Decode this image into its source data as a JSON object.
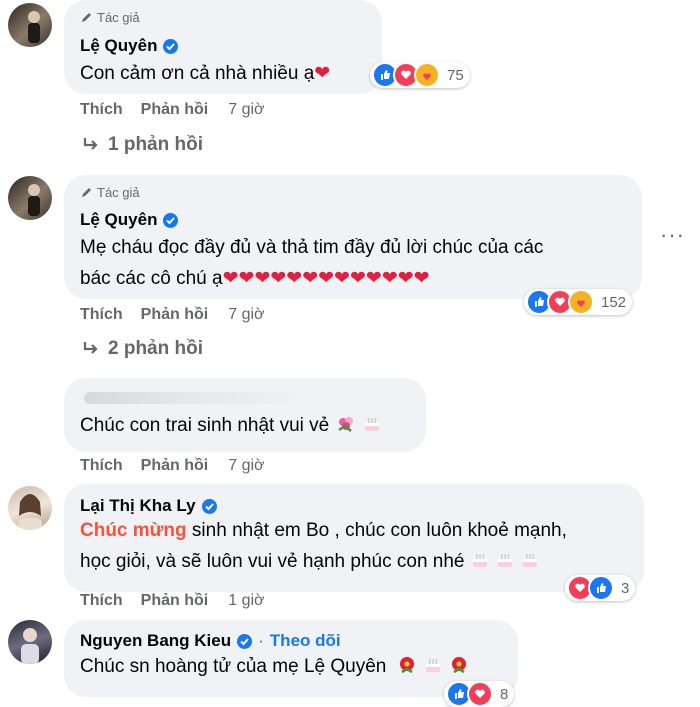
{
  "comments": [
    {
      "author_badge": "Tác giả",
      "author": "Lệ Quyên",
      "text": "Con cảm ơn cả nhà nhiều ạ❤",
      "reaction_count": "75",
      "like": "Thích",
      "reply": "Phản hồi",
      "time": "7 giờ",
      "replies_label": "1 phản hồi"
    },
    {
      "author_badge": "Tác giả",
      "author": "Lệ Quyên",
      "text_line1": "Mẹ cháu đọc đầy đủ và thả tim đầy đủ lời chúc của các",
      "text_line2": "bác các cô chú ạ❤❤❤❤❤❤❤❤❤❤❤❤❤",
      "reaction_count": "152",
      "like": "Thích",
      "reply": "Phản hồi",
      "time": "7 giờ",
      "replies_label": "2 phản hồi",
      "more": "···"
    },
    {
      "text": "Chúc con trai sinh nhật vui vẻ",
      "like": "Thích",
      "reply": "Phản hồi",
      "time": "7 giờ"
    },
    {
      "author": "Lại Thị Kha Ly",
      "highlight": "Chúc mừng",
      "text_line1_rest": " sinh nhật em Bo , chúc con luôn khoẻ mạnh,",
      "text_line2": "học giỏi, và sẽ luôn vui vẻ hạnh phúc con nhé",
      "reaction_count": "3",
      "like": "Thích",
      "reply": "Phản hồi",
      "time": "1 giờ"
    },
    {
      "author": "Nguyen Bang Kieu",
      "follow": "Theo dõi",
      "text": "Chúc sn hoàng tử của mẹ ",
      "mention": "Lệ Quyên",
      "reaction_count": "8"
    }
  ],
  "colors": {
    "bubble": "#f0f2f5",
    "secondary_text": "#65676b",
    "link_blue": "#1877f2",
    "highlight_orange": "#f5533d",
    "like_blue": "#1877f2",
    "love_red": "#f33e58",
    "care_yellow": "#f7b125"
  },
  "icons": [
    "pencil-icon",
    "verified-icon",
    "like-icon",
    "love-icon",
    "care-icon",
    "reply-arrow-icon",
    "more-icon",
    "cake-icon",
    "flower-icon"
  ]
}
